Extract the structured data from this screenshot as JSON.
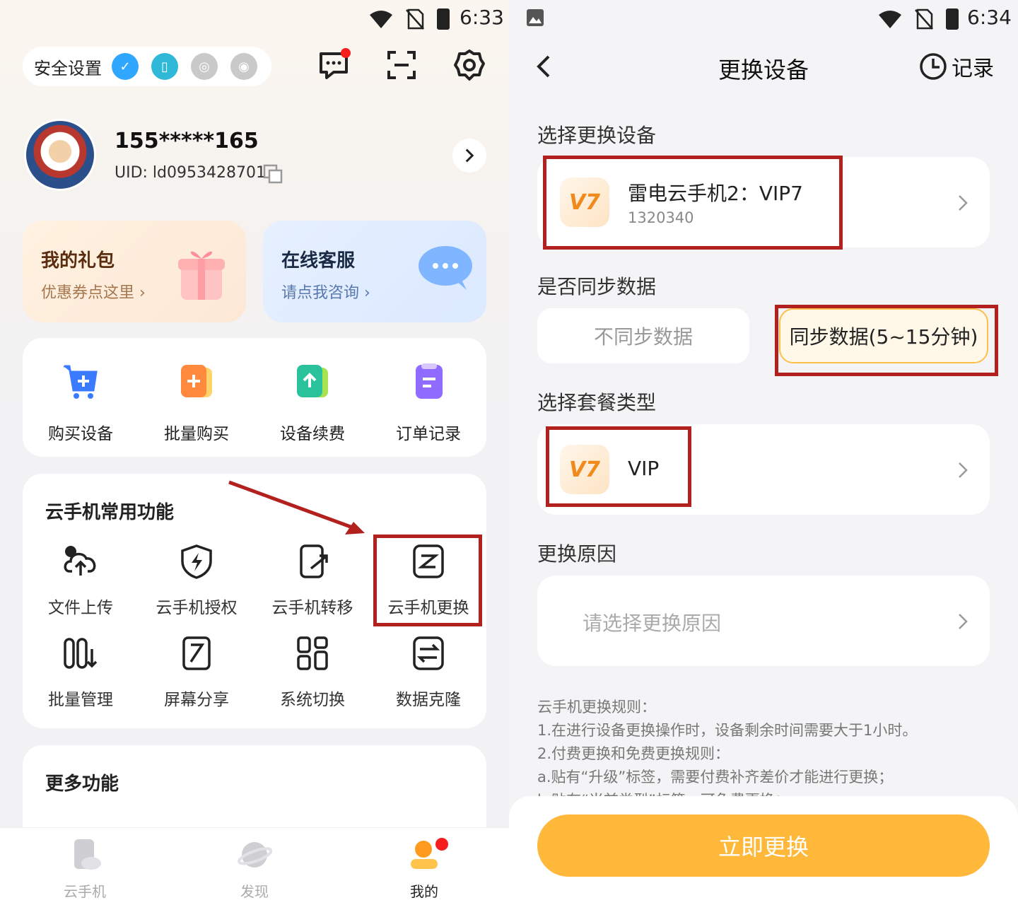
{
  "left": {
    "status": {
      "time": "6:33"
    },
    "security": {
      "label": "安全设置"
    },
    "user": {
      "phone": "155*****165",
      "uid": "UID: ld0953428701"
    },
    "gift": {
      "title": "我的礼包",
      "sub": "优惠券点这里 ›"
    },
    "service": {
      "title": "在线客服",
      "sub": "请点我咨询 ›"
    },
    "quick": [
      {
        "label": "购买设备",
        "icon": "cart-icon",
        "color": "#3b7bff"
      },
      {
        "label": "批量购买",
        "icon": "batch-buy-icon",
        "color": "#ff8a3d"
      },
      {
        "label": "设备续费",
        "icon": "renew-icon",
        "color": "#29c29a"
      },
      {
        "label": "订单记录",
        "icon": "order-icon",
        "color": "#8f6bff"
      }
    ],
    "common": {
      "title": "云手机常用功能",
      "items": [
        {
          "label": "文件上传",
          "icon": "cloud-upload-icon"
        },
        {
          "label": "云手机授权",
          "icon": "shield-bolt-icon"
        },
        {
          "label": "云手机转移",
          "icon": "transfer-icon"
        },
        {
          "label": "云手机更换",
          "icon": "swap-icon"
        },
        {
          "label": "批量管理",
          "icon": "batch-manage-icon"
        },
        {
          "label": "屏幕分享",
          "icon": "screen-share-icon"
        },
        {
          "label": "系统切换",
          "icon": "system-switch-icon"
        },
        {
          "label": "数据克隆",
          "icon": "data-clone-icon"
        }
      ]
    },
    "more": {
      "title": "更多功能"
    },
    "tabs": [
      {
        "label": "云手机",
        "icon": "cloud-phone-icon"
      },
      {
        "label": "发现",
        "icon": "planet-icon"
      },
      {
        "label": "我的",
        "icon": "profile-icon"
      }
    ]
  },
  "right": {
    "status": {
      "time": "6:34"
    },
    "nav": {
      "title": "更换设备",
      "record": "记录"
    },
    "select_device": {
      "label": "选择更换设备",
      "badge": "V7",
      "name": "雷电云手机2：VIP7",
      "id": "1320340"
    },
    "sync": {
      "label": "是否同步数据",
      "no": "不同步数据",
      "yes": "同步数据(5~15分钟)"
    },
    "package": {
      "label": "选择套餐类型",
      "badge": "V7",
      "name": "VIP"
    },
    "reason": {
      "label": "更换原因",
      "placeholder": "请选择更换原因"
    },
    "rules": [
      "云手机更换规则：",
      "1.在进行设备更换操作时，设备剩余时间需要大于1小时。",
      "2.付费更换和免费更换规则：",
      "a.贴有“升级”标签，需要付费补齐差价才能进行更换；",
      "b.贴有“当前类型”标签，可免费更换；"
    ],
    "cta": "立即更换"
  }
}
